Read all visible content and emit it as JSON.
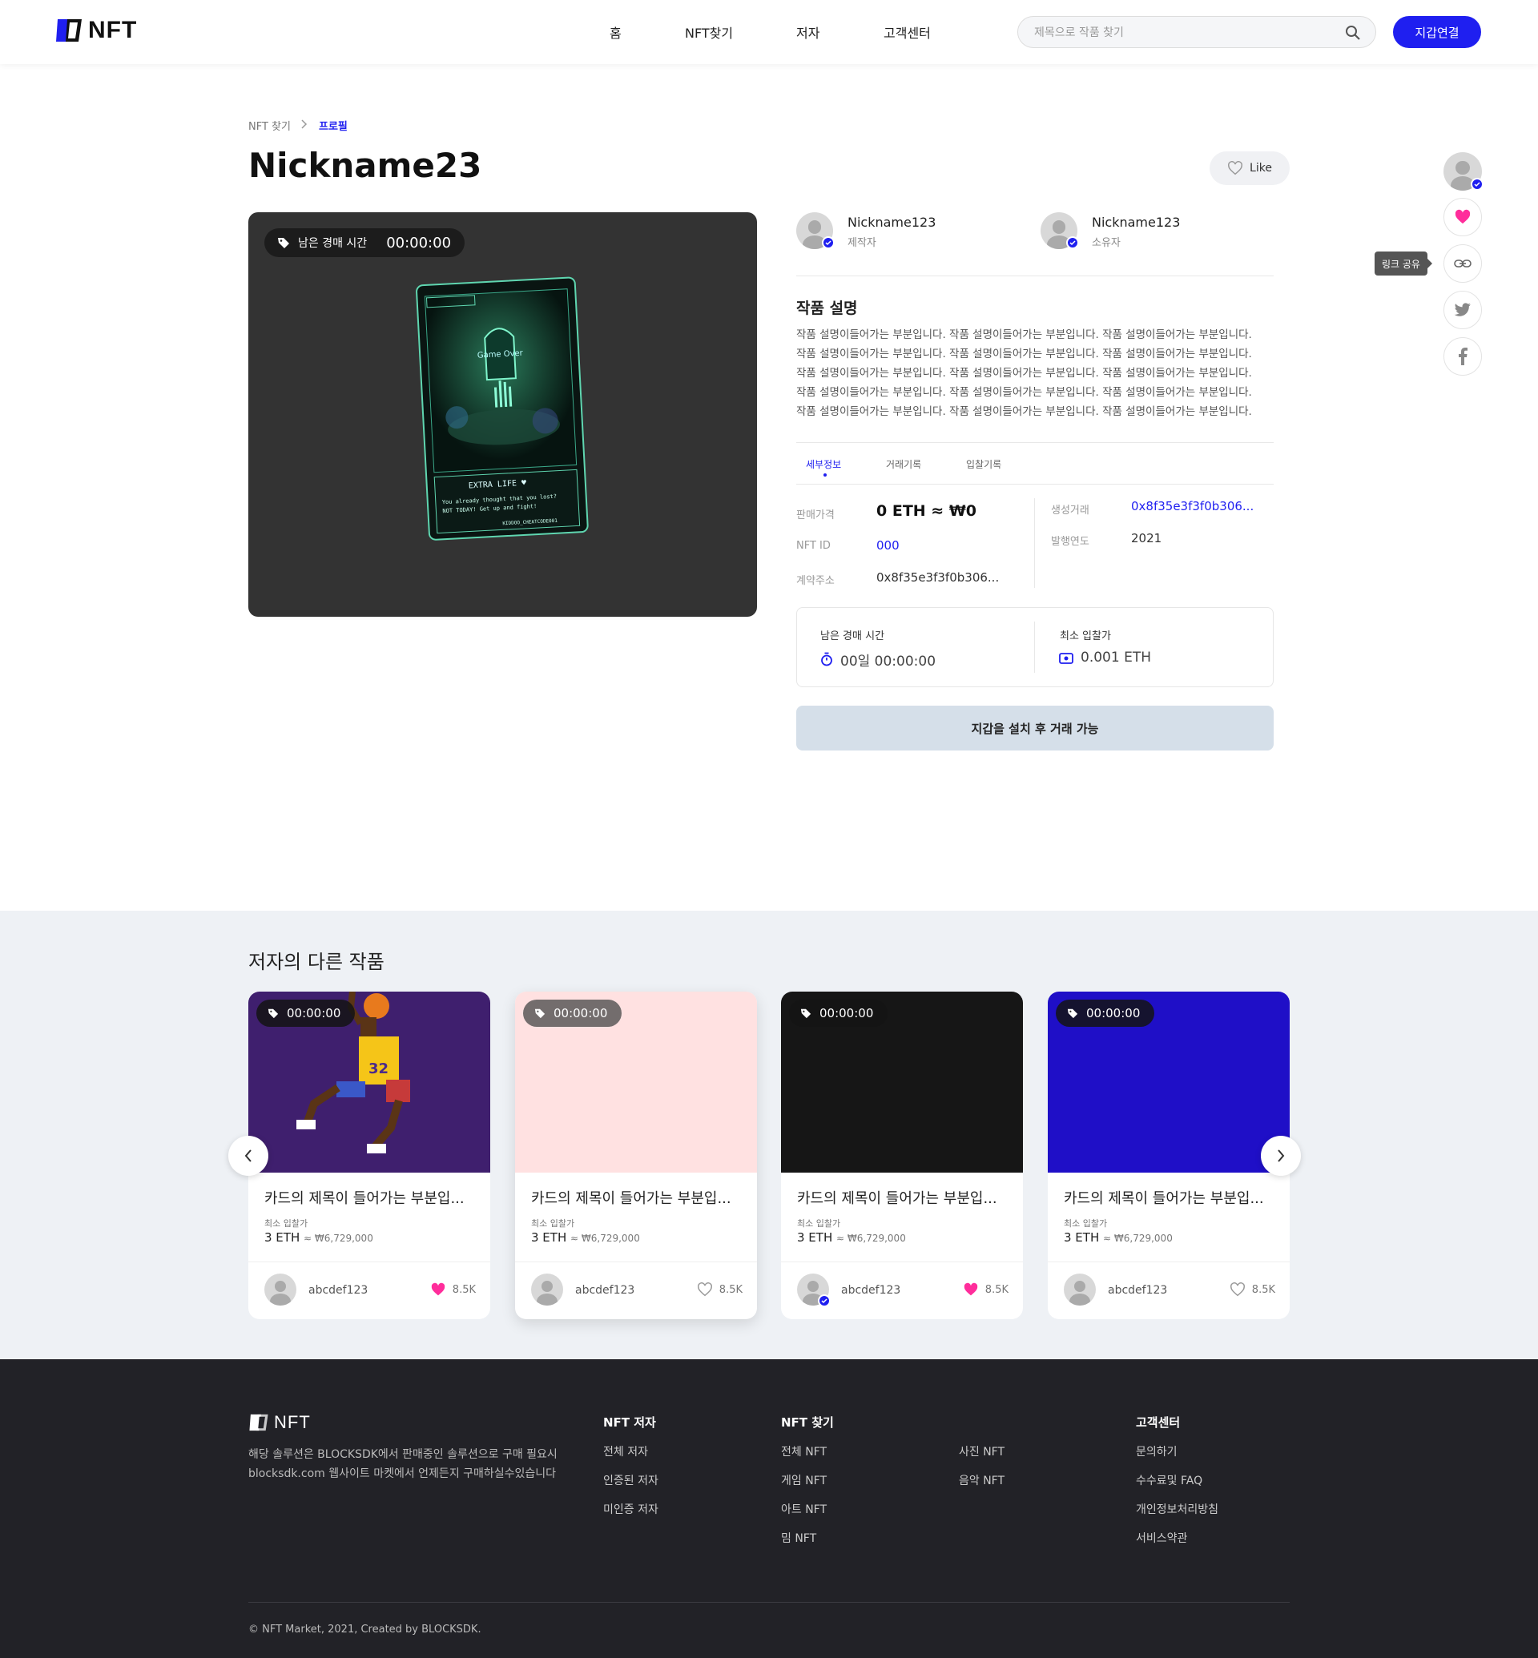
{
  "header": {
    "logo": "NFT",
    "nav": [
      "홈",
      "NFT찾기",
      "저자",
      "고객센터"
    ],
    "search_placeholder": "제목으로 작품 찾기",
    "wallet_button": "지갑연결"
  },
  "breadcrumb": {
    "parent": "NFT 찾기",
    "current": "프로필"
  },
  "page_title": "Nickname23",
  "like_button": "Like",
  "share_tooltip": "링크 공유",
  "media": {
    "timer_label": "남은 경매 시간",
    "timer_value": "00:00:00"
  },
  "creator": {
    "name": "Nickname123",
    "role": "제작자"
  },
  "owner": {
    "name": "Nickname123",
    "role": "소유자"
  },
  "description": {
    "title": "작품 설명",
    "text": "작품 설명이들어가는 부분입니다. 작품 설명이들어가는 부분입니다. 작품 설명이들어가는 부분입니다. 작품 설명이들어가는 부분입니다. 작품 설명이들어가는 부분입니다. 작품 설명이들어가는 부분입니다. 작품 설명이들어가는 부분입니다. 작품 설명이들어가는 부분입니다. 작품 설명이들어가는 부분입니다. 작품 설명이들어가는 부분입니다. 작품 설명이들어가는 부분입니다. 작품 설명이들어가는 부분입니다. 작품 설명이들어가는 부분입니다. 작품 설명이들어가는 부분입니다. 작품 설명이들어가는 부분입니다."
  },
  "tabs": [
    "세부정보",
    "거래기록",
    "입찰기록"
  ],
  "details": {
    "price_label": "판매가격",
    "price_value": "0 ETH ≈ ₩0",
    "nftid_label": "NFT ID",
    "nftid_value": "000",
    "contract_label": "계약주소",
    "contract_value": "0x8f35e3f3f0b306...",
    "create_label": "생성거래",
    "create_value": "0x8f35e3f3f0b306...",
    "year_label": "발행연도",
    "year_value": "2021"
  },
  "auction": {
    "time_label": "남은 경매 시간",
    "time_value": "00일 00:00:00",
    "bid_label": "최소 입찰가",
    "bid_value": "0.001 ETH"
  },
  "trade_button": "지갑을 설치 후 거래 가능",
  "other_works": {
    "title": "저자의 다른 작품",
    "cards": [
      {
        "timer": "00:00:00",
        "title": "카드의 제목이 들어가는 부분입...",
        "min_label": "최소 입찰가",
        "price": "3 ETH",
        "krw": "≈ ₩6,729,000",
        "owner": "abcdef123",
        "likes": "8.5K",
        "liked": true,
        "bg": "#3f1f6e"
      },
      {
        "timer": "00:00:00",
        "title": "카드의 제목이 들어가는 부분입...",
        "min_label": "최소 입찰가",
        "price": "3 ETH",
        "krw": "≈ ₩6,729,000",
        "owner": "abcdef123",
        "likes": "8.5K",
        "liked": false,
        "bg": "#ffe1e1"
      },
      {
        "timer": "00:00:00",
        "title": "카드의 제목이 들어가는 부분입...",
        "min_label": "최소 입찰가",
        "price": "3 ETH",
        "krw": "≈ ₩6,729,000",
        "owner": "abcdef123",
        "likes": "8.5K",
        "liked": true,
        "bg": "#161616"
      },
      {
        "timer": "00:00:00",
        "title": "카드의 제목이 들어가는 부분입...",
        "min_label": "최소 입찰가",
        "price": "3 ETH",
        "krw": "≈ ₩6,729,000",
        "owner": "abcdef123",
        "likes": "8.5K",
        "liked": false,
        "bg": "#1f0fc7"
      }
    ]
  },
  "footer": {
    "logo": "NFT",
    "desc": "해당 솔루션은 BLOCKSDK에서 판매중인 솔루션으로 구매 필요시 blocksdk.com 웹사이트 마켓에서 언제든지 구매하실수있습니다",
    "col1": {
      "title": "NFT 저자",
      "items": [
        "전체 저자",
        "인증된 저자",
        "미인증 저자"
      ]
    },
    "col2": {
      "title": "NFT 찾기",
      "items": [
        "전체 NFT",
        "게임 NFT",
        "아트 NFT",
        "밈 NFT"
      ]
    },
    "col3": {
      "items": [
        "사진 NFT",
        "음악 NFT"
      ]
    },
    "col4": {
      "title": "고객센터",
      "items": [
        "문의하기",
        "수수료및 FAQ",
        "개인정보처리방침",
        "서비스약관"
      ]
    },
    "copyright": "© NFT Market, 2021, Created by BLOCKSDK."
  },
  "colors": {
    "accent": "#1f1ff0",
    "like_pink": "#ff2d9b"
  }
}
